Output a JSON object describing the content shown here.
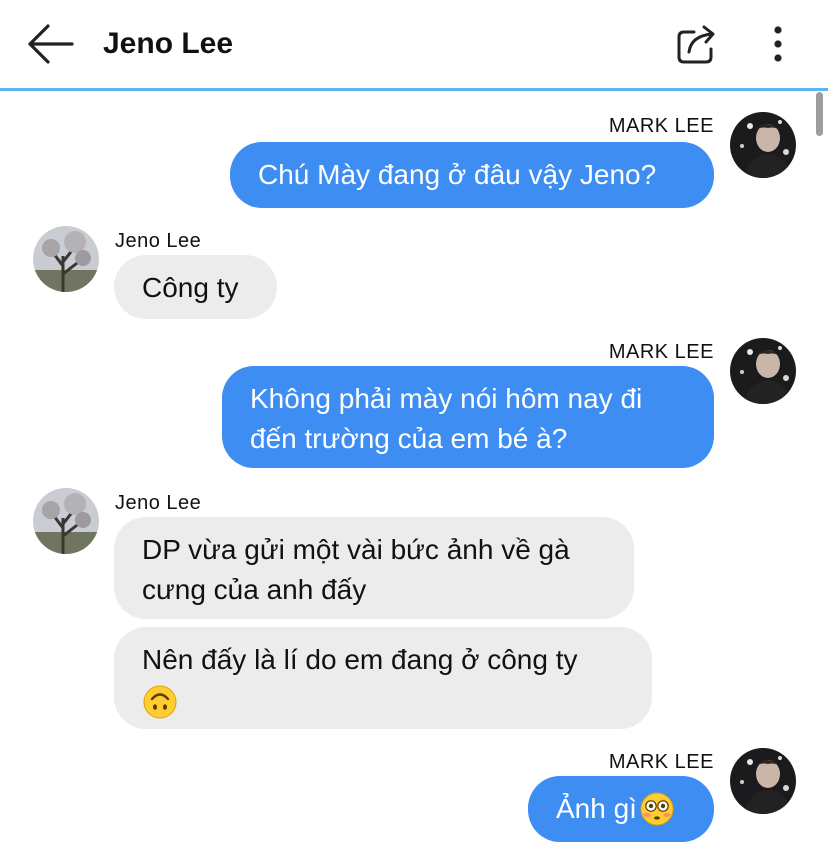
{
  "header": {
    "title": "Jeno Lee",
    "back_icon": "arrow-left-icon",
    "share_icon": "share-icon",
    "more_icon": "more-vertical-icon"
  },
  "colors": {
    "accent": "#5cb6ee",
    "outgoing_bubble": "#3d8df3",
    "incoming_bubble": "#ececec"
  },
  "messages": [
    {
      "sender": "MARK LEE",
      "text": "Chú Mày đang ở đâu vậy Jeno?"
    },
    {
      "sender": "Jeno Lee",
      "text": "Công ty"
    },
    {
      "sender": "MARK LEE",
      "line1": "Không phải mày nói hôm nay đi",
      "line2": "đến trường của em bé à?"
    },
    {
      "sender": "Jeno Lee",
      "line1": "DP vừa gửi một vài bức ảnh về gà",
      "line2": "cưng của anh đấy"
    },
    {
      "line1": "Nên đấy là lí do em đang ở công ty",
      "emoji": "upside-down-face-emoji"
    },
    {
      "sender": "MARK LEE",
      "text": "Ảnh gì",
      "emoji": "flushed-face-emoji"
    }
  ]
}
